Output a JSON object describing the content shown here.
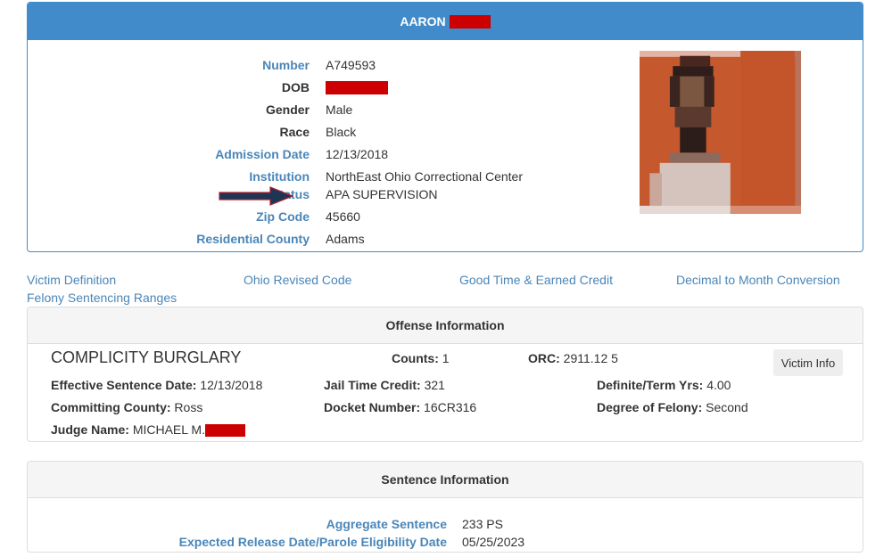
{
  "profile": {
    "name_visible": "AARON",
    "name_redacted": true,
    "fields": [
      {
        "label": "Number",
        "value": "A749593",
        "style": "link"
      },
      {
        "label": "DOB",
        "value": "",
        "redacted": true,
        "style": "plain"
      },
      {
        "label": "Gender",
        "value": "Male",
        "style": "plain"
      },
      {
        "label": "Race",
        "value": "Black",
        "style": "plain"
      },
      {
        "label": "Admission Date",
        "value": "12/13/2018",
        "style": "link"
      },
      {
        "label": "Institution",
        "value": "NorthEast Ohio Correctional Center",
        "style": "link"
      },
      {
        "label": "Status",
        "value": "APA SUPERVISION",
        "style": "link",
        "highlighted_by_arrow": true
      },
      {
        "label": "Zip Code",
        "value": "45660",
        "style": "link"
      },
      {
        "label": "Residential County",
        "value": "Adams",
        "style": "link"
      }
    ],
    "photo": "pixelated-inmate-photo"
  },
  "links": [
    {
      "label": "Victim Definition"
    },
    {
      "label": "Ohio Revised Code"
    },
    {
      "label": "Good Time & Earned Credit"
    },
    {
      "label": "Decimal to Month Conversion"
    },
    {
      "label": "Felony Sentencing Ranges"
    }
  ],
  "offense": {
    "heading": "Offense Information",
    "title": "COMPLICITY BURGLARY",
    "counts_label": "Counts:",
    "counts": "1",
    "orc_label": "ORC:",
    "orc": "2911.12 5",
    "victim_info_button": "Victim Info",
    "effective_sentence_date_label": "Effective Sentence Date:",
    "effective_sentence_date": "12/13/2018",
    "jail_time_credit_label": "Jail Time Credit:",
    "jail_time_credit": "321",
    "definite_term_label": "Definite/Term Yrs:",
    "definite_term": "4.00",
    "committing_county_label": "Committing County:",
    "committing_county": "Ross",
    "docket_number_label": "Docket Number:",
    "docket_number": "16CR316",
    "degree_label": "Degree of Felony:",
    "degree": "Second",
    "judge_label": "Judge Name:",
    "judge_visible": "MICHAEL M.",
    "judge_redacted": true
  },
  "sentence": {
    "heading": "Sentence Information",
    "rows": [
      {
        "label": "Aggregate Sentence",
        "value": "233 PS"
      },
      {
        "label": "Expected Release Date/Parole Eligibility Date",
        "value": "05/25/2023"
      }
    ]
  },
  "colors": {
    "header_blue": "#428bca",
    "label_blue": "#4a86b8",
    "redaction_red": "#cc0000",
    "arrow_navy": "#1f3556"
  }
}
